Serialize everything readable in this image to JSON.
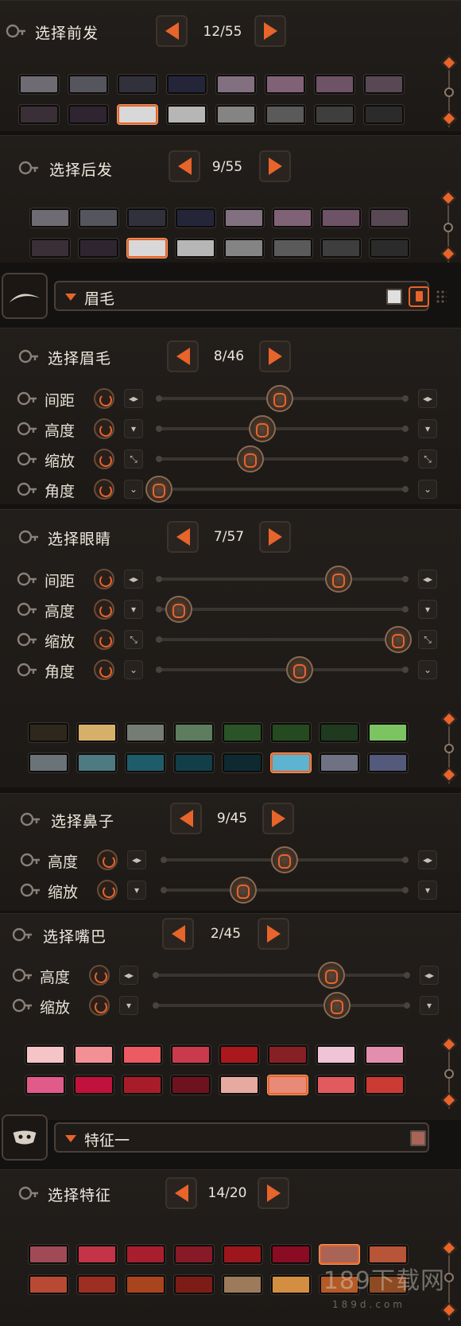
{
  "front_hair": {
    "title": "选择前发",
    "counter": "12/55"
  },
  "back_hair": {
    "title": "选择后发",
    "counter": "9/55"
  },
  "eyebrow_category": {
    "label": "眉毛"
  },
  "eyebrow": {
    "title": "选择眉毛",
    "counter": "8/46",
    "rows": [
      {
        "label": "间距",
        "value": 0.49
      },
      {
        "label": "高度",
        "value": 0.42
      },
      {
        "label": "缩放",
        "value": 0.37
      },
      {
        "label": "角度",
        "value": 0.0
      }
    ]
  },
  "eyes": {
    "title": "选择眼睛",
    "counter": "7/57",
    "rows": [
      {
        "label": "间距",
        "value": 0.73
      },
      {
        "label": "高度",
        "value": 0.08
      },
      {
        "label": "缩放",
        "value": 0.97
      },
      {
        "label": "角度",
        "value": 0.57
      }
    ]
  },
  "nose": {
    "title": "选择鼻子",
    "counter": "9/45",
    "rows": [
      {
        "label": "高度",
        "value": 0.5
      },
      {
        "label": "缩放",
        "value": 0.33
      }
    ]
  },
  "mouth": {
    "title": "选择嘴巴",
    "counter": "2/45",
    "rows": [
      {
        "label": "高度",
        "value": 0.7
      },
      {
        "label": "缩放",
        "value": 0.72
      }
    ]
  },
  "feature_category": {
    "label": "特征一"
  },
  "feature": {
    "title": "选择特征",
    "counter": "14/20"
  },
  "colors": {
    "accent": "#e7642a",
    "hair_grid": [
      "#6e6c72",
      "#55555d",
      "#31313b",
      "#25253a",
      "#827080",
      "#806276",
      "#6e5266",
      "#574854",
      "#3a2f36",
      "#2e2530",
      "#d8d8d8",
      "#b6b6b6",
      "#848484",
      "#5a5a5a",
      "#3e3e3e",
      "#2b2b2b"
    ],
    "eye_grid": [
      "#2e281c",
      "#d6b06a",
      "#747c74",
      "#5e7c5e",
      "#2a5428",
      "#254a22",
      "#1f3a1e",
      "#7cc462",
      "#6a7478",
      "#4e7a82",
      "#1f5c6a",
      "#123e48",
      "#0e2a30",
      "#5cb4d0",
      "#6e7282",
      "#535a7c"
    ],
    "mouth_grid": [
      "#f4c4c6",
      "#f29096",
      "#ec5a62",
      "#c83a4c",
      "#a8181c",
      "#862024",
      "#eec4d6",
      "#e28eac",
      "#e05a8a",
      "#c0123c",
      "#a81c2a",
      "#6e1220",
      "#e6aaa0",
      "#e88a78",
      "#e05a5e",
      "#cc3a34"
    ],
    "feature_grid": [
      "#a04a56",
      "#c43448",
      "#a81e2e",
      "#861a26",
      "#9c161c",
      "#8a0c22",
      "#a86456",
      "#b85438",
      "#b84a34",
      "#9c2e22",
      "#a8441e",
      "#7c1c16",
      "#9c7a5a",
      "#d48e42",
      "#b45a26",
      "#8e4a22"
    ]
  },
  "watermark": {
    "text": "189下载网",
    "sub": "189d.com"
  }
}
